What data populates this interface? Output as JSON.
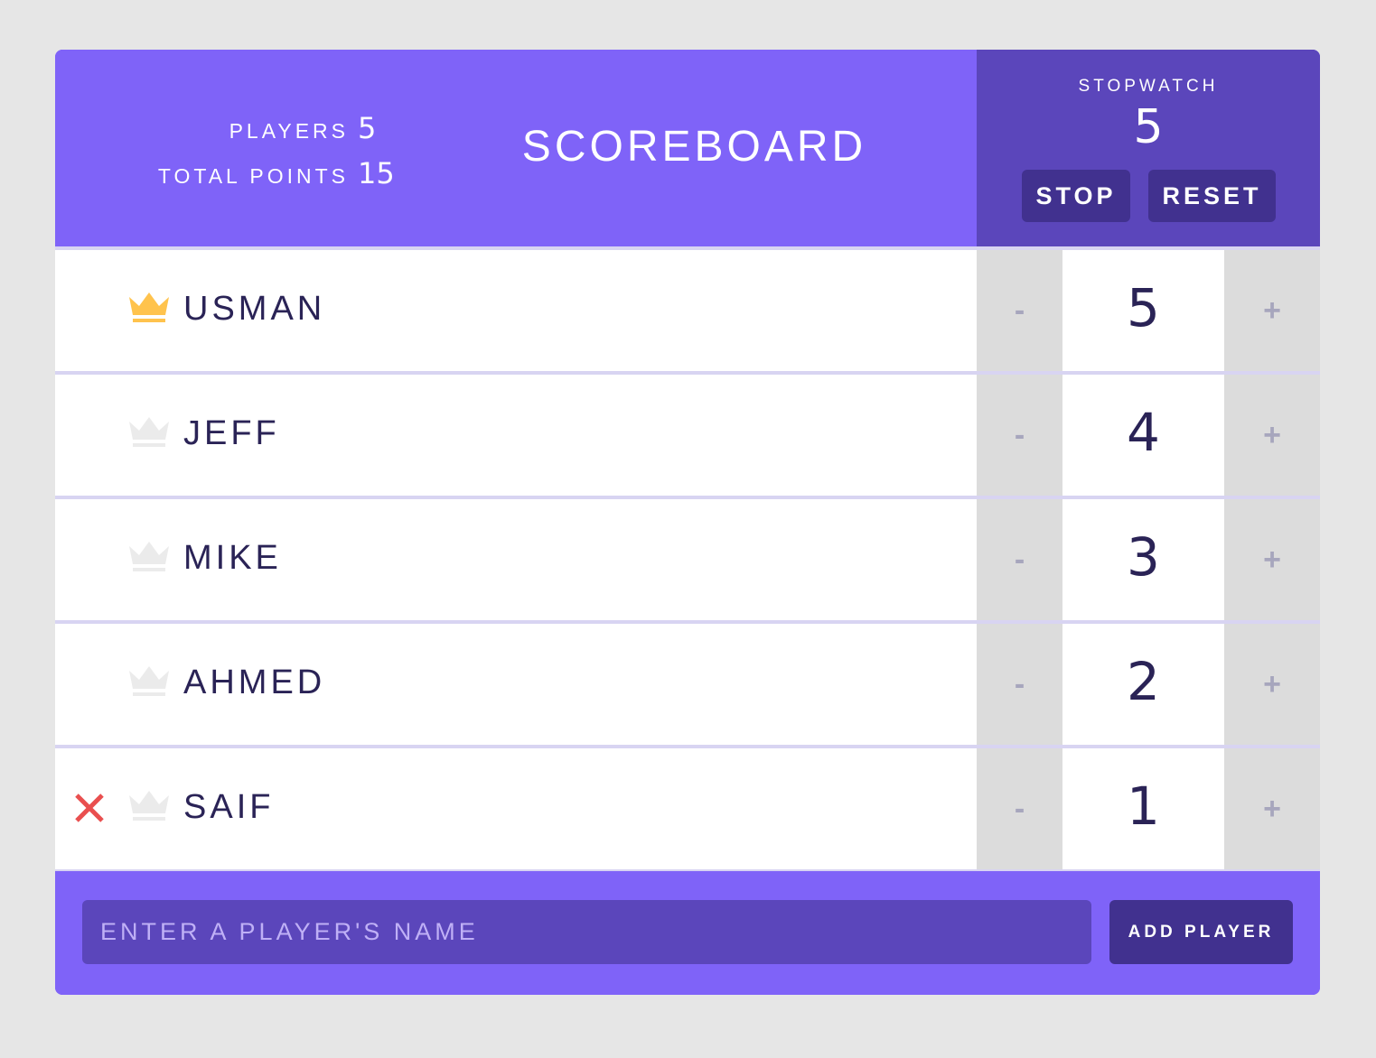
{
  "header": {
    "players_label": "PLAYERS",
    "players_count": "5",
    "total_points_label": "TOTAL POINTS",
    "total_points": "15",
    "title": "SCOREBOARD"
  },
  "stopwatch": {
    "label": "STOPWATCH",
    "time": "5",
    "stop_label": "STOP",
    "reset_label": "RESET"
  },
  "players": [
    {
      "name": "USMAN",
      "score": "5",
      "dec_label": "-",
      "inc_label": "+",
      "crown": "gold",
      "remove_icon_visible": false
    },
    {
      "name": "JEFF",
      "score": "4",
      "dec_label": "-",
      "inc_label": "+",
      "crown": "inactive",
      "remove_icon_visible": false
    },
    {
      "name": "MIKE",
      "score": "3",
      "dec_label": "-",
      "inc_label": "+",
      "crown": "inactive",
      "remove_icon_visible": false
    },
    {
      "name": "AHMED",
      "score": "2",
      "dec_label": "-",
      "inc_label": "+",
      "crown": "inactive",
      "remove_icon_visible": false
    },
    {
      "name": "SAIF",
      "score": "1",
      "dec_label": "-",
      "inc_label": "+",
      "crown": "inactive",
      "remove_icon_visible": true
    }
  ],
  "footer": {
    "input_placeholder": "ENTER A PLAYER'S NAME",
    "input_value": "",
    "add_label": "ADD PLAYER"
  },
  "colors": {
    "primary": "#7f63f8",
    "primary_dark": "#5b46bb",
    "button_dark": "#41318f",
    "text_dark": "#2a2356",
    "crown_gold": "#ffc34d",
    "crown_inactive": "#ebebeb",
    "remove_red": "#e94f4f",
    "counter_bg": "#dcdcdc"
  },
  "icons": {
    "crown": "crown-icon",
    "remove": "close-icon"
  }
}
